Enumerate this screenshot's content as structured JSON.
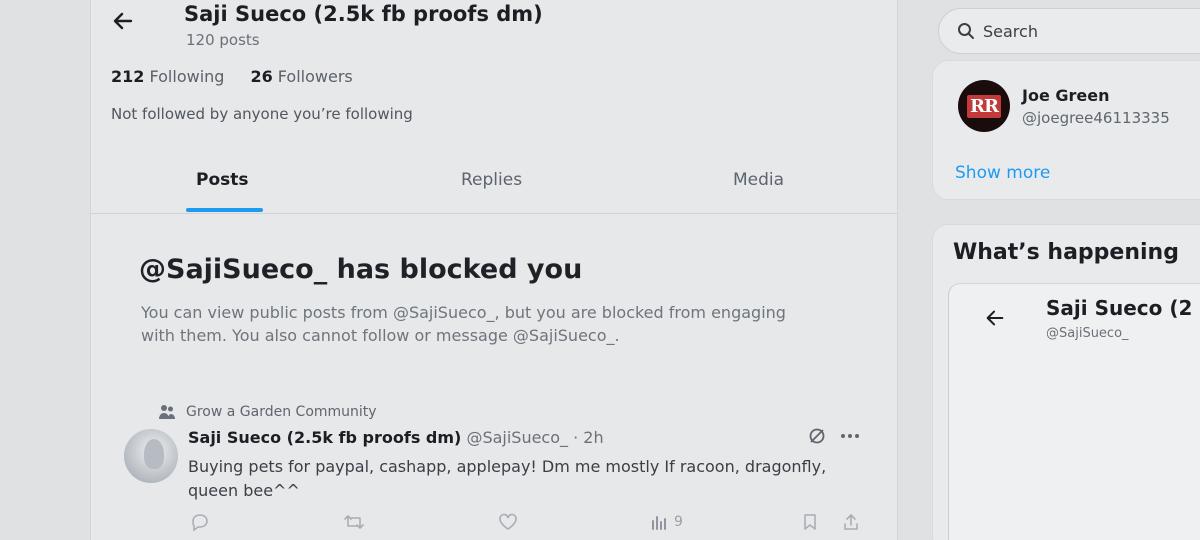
{
  "header": {
    "back_icon": "arrow-left-icon",
    "profile_name": "Saji Sueco (2.5k fb proofs dm)",
    "post_count": "120 posts"
  },
  "profile": {
    "following_count": "212",
    "following_label": "Following",
    "followers_count": "26",
    "followers_label": "Followers",
    "not_followed_text": "Not followed by anyone you’re following"
  },
  "tabs": [
    {
      "label": "Posts",
      "active": true
    },
    {
      "label": "Replies",
      "active": false
    },
    {
      "label": "Media",
      "active": false
    }
  ],
  "blocked": {
    "title": "@SajiSueco_ has blocked you",
    "description": "You can view public posts from @SajiSueco_, but you are blocked from engaging with them. You also cannot follow or message @SajiSueco_."
  },
  "post": {
    "community_icon": "community-icon",
    "community_name": "Grow a Garden Community",
    "author_name": "Saji Sueco (2.5k fb proofs dm)",
    "handle_time": "@SajiSueco_ · 2h",
    "text": "Buying pets for paypal, cashapp, applepay! Dm me mostly If racoon, dragonfly, queen bee^^",
    "views": "9"
  },
  "sidebar": {
    "search_placeholder": "Search",
    "who_to_follow": {
      "avatar_text": "RR",
      "name": "Joe Green",
      "handle": "@joegree46113335"
    },
    "show_more": "Show more",
    "whats_happening_title": "What’s happening",
    "embed": {
      "name": "Saji Sueco (2",
      "handle": "@SajiSueco_"
    }
  },
  "colors": {
    "accent": "#1d9bf0",
    "background": "#e6e8ea"
  }
}
